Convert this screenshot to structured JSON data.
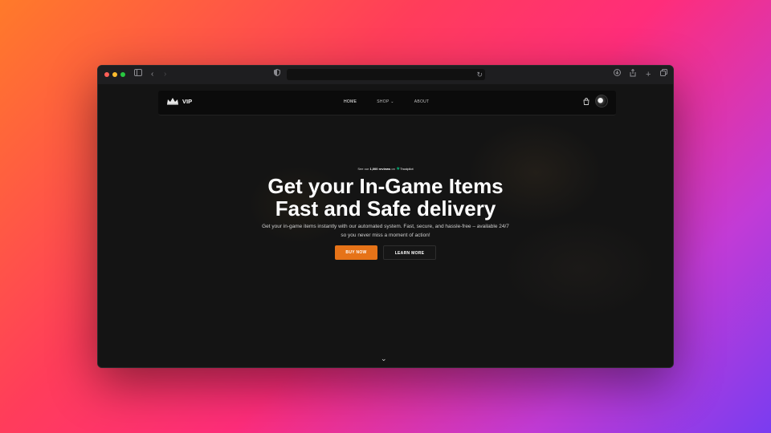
{
  "browser": {
    "icons": [
      "sidebar-icon",
      "back-icon",
      "forward-icon",
      "shield-icon",
      "reload-icon",
      "download-icon",
      "share-icon",
      "new-tab-icon",
      "tabs-overview-icon"
    ]
  },
  "nav": {
    "brand": "VIP",
    "links": [
      "HOME",
      "SHOP",
      "ABOUT"
    ],
    "shop_caret": "⌄"
  },
  "hero": {
    "trustpilot_prefix": "See our ",
    "trustpilot_count": "1,000 reviews",
    "trustpilot_on": " on ",
    "trustpilot_star": "★",
    "trustpilot_brand": "Trustpilot",
    "headline_line1": "Get your In-Game Items",
    "headline_line2": "Fast and Safe delivery",
    "subtitle_line1": "Get your in-game items instantly with our automated system. Fast, secure, and hassle-free – available 24/7",
    "subtitle_line2": "so you never miss a moment of action!",
    "buy_label": "BUY NOW",
    "learn_label": "LEARN MORE"
  },
  "scroll_hint": "⌄",
  "colors": {
    "accent": "#e67318",
    "trustpilot_star": "#00b67a",
    "page_bg": "#141414"
  }
}
